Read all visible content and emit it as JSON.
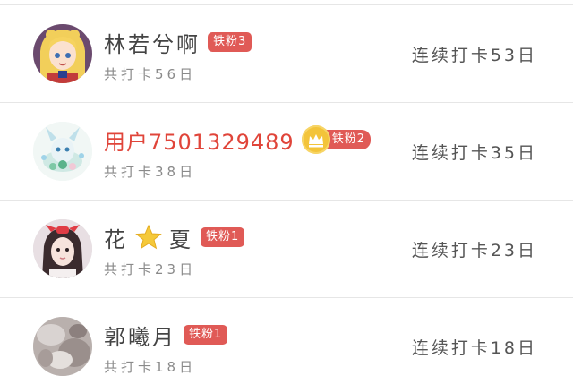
{
  "users": [
    {
      "name": "林若兮啊",
      "badge": "铁粉3",
      "total": "共打卡56日",
      "streak": "连续打卡53日",
      "avatar_icon": "anime-girl-avatar"
    },
    {
      "name": "用户7501329489",
      "badge": "铁粉2",
      "total": "共打卡38日",
      "streak": "连续打卡35日",
      "avatar_icon": "fantasy-creature-avatar",
      "badge_icon": "crown-icon"
    },
    {
      "name_before": "花",
      "name_after": "夏",
      "badge": "铁粉1",
      "total": "共打卡23日",
      "streak": "连续打卡23日",
      "avatar_icon": "girl-with-bow-avatar",
      "name_icon": "star-icon"
    },
    {
      "name": "郭曦月",
      "badge": "铁粉1",
      "total": "共打卡18日",
      "streak": "连续打卡18日",
      "avatar_icon": "blurred-photo-avatar"
    }
  ],
  "colors": {
    "badge_bg": "#e05a56",
    "name_highlight": "#e0453a",
    "crown": "#f3c43a",
    "star": "#f5c93a"
  }
}
